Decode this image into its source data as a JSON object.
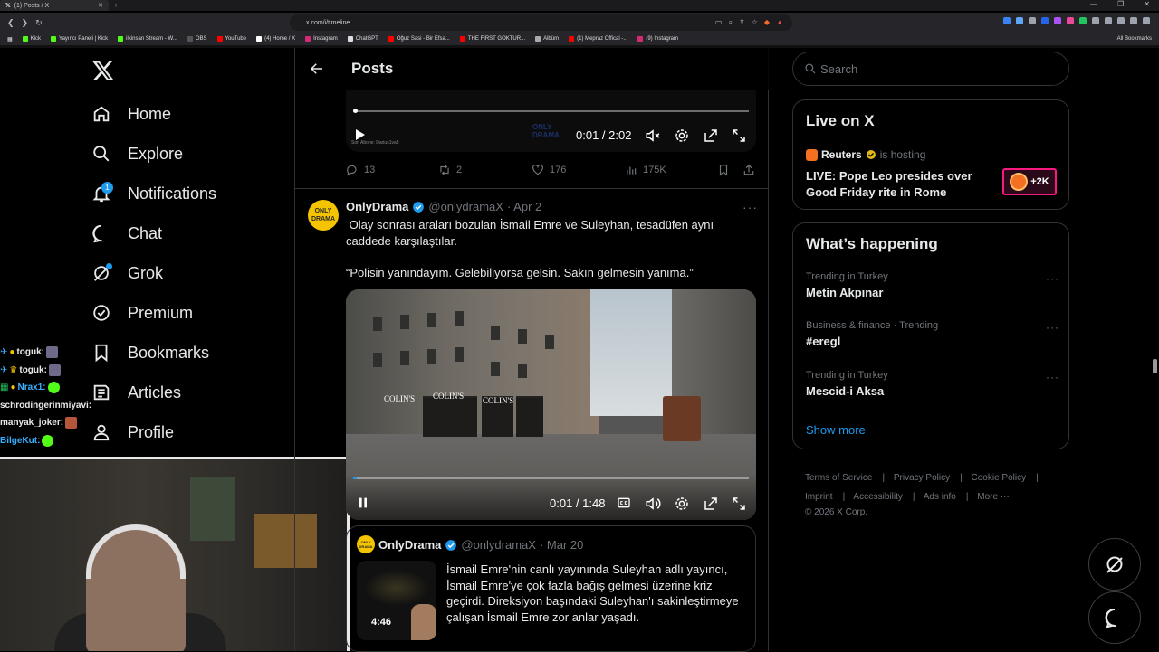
{
  "browser": {
    "tab_title": "(1) Posts / X",
    "url": "x.com/i/timeline",
    "bookmarks": [
      "Kick",
      "Yayıncı Paneli | Kick",
      "ilkinsan Stream - W...",
      "OBS",
      "YouTube",
      "(4) Home / X",
      "Instagram",
      "ChatGPT",
      "Oğuz Sasi - Bir Efsa...",
      "THE FIRST GOKTUR...",
      "Albüm",
      "(1) Mepraz Offical -...",
      "(9) Instagram"
    ],
    "all_bookmarks": "All Bookmarks"
  },
  "nav": {
    "items": [
      {
        "label": "Home",
        "icon": "home-icon"
      },
      {
        "label": "Explore",
        "icon": "search-icon"
      },
      {
        "label": "Notifications",
        "icon": "bell-icon"
      },
      {
        "label": "Chat",
        "icon": "chat-icon"
      },
      {
        "label": "Grok",
        "icon": "grok-icon"
      },
      {
        "label": "Premium",
        "icon": "premium-icon"
      },
      {
        "label": "Bookmarks",
        "icon": "bookmark-icon"
      },
      {
        "label": "Articles",
        "icon": "article-icon"
      },
      {
        "label": "Profile",
        "icon": "profile-icon"
      }
    ],
    "notification_count": "1"
  },
  "stream_chat": [
    {
      "user": "toguk:",
      "color": "#e9e9e9"
    },
    {
      "user": "toguk:",
      "color": "#e9e9e9"
    },
    {
      "user": "Nrax1:",
      "color": "#3bb0ff"
    },
    {
      "user": "schrodingerinmiyavi:",
      "color": "#e9e9e9"
    },
    {
      "user": "manyak_joker:",
      "color": "#e9e9e9"
    },
    {
      "user": "BilgeKut:",
      "color": "#3bb0ff"
    }
  ],
  "header": {
    "title": "Posts"
  },
  "video1": {
    "time": "0:01 / 2:02",
    "watermark": "Son Abone: Darius1va5"
  },
  "actions1": {
    "replies": "13",
    "reposts": "2",
    "likes": "176",
    "views": "175K"
  },
  "post": {
    "name": "OnlyDrama",
    "handle": "@onlydramaX",
    "date": "· Apr 2",
    "avatar_text": "ONLY DRAMA",
    "text": " Olay sonrası araları bozulan İsmail Emre ve Suleyhan, tesadüfen aynı caddede karşılaştılar.\n\n“Polisin yanındayım. Gelebiliyorsa gelsin. Sakın gelmesin yanıma.”",
    "video_time": "0:01 / 1:48",
    "shop_signs": [
      "COLIN'S",
      "COLIN'S",
      "COLIN'S"
    ]
  },
  "quote": {
    "name": "OnlyDrama",
    "handle": "@onlydramaX",
    "date": "· Mar 20",
    "duration": "4:46",
    "text": "İsmail Emre'nin canlı yayınında Suleyhan adlı yayıncı, İsmail Emre'ye çok fazla bağış gelmesi üzerine kriz geçirdi. Direksiyon başındaki Suleyhan'ı sakinleştirmeye çalışan İsmail Emre zor anlar yaşadı."
  },
  "sidebar": {
    "search_placeholder": "Search",
    "live": {
      "title": "Live on X",
      "host": "Reuters",
      "hosting_text": "is hosting",
      "stream_title": "LIVE: Pope Leo presides over Good Friday rite in Rome",
      "listeners": "+2K"
    },
    "happening": {
      "title": "What’s happening",
      "trends": [
        {
          "context": "Trending in Turkey",
          "name": "Metin Akpınar"
        },
        {
          "context": "Business & finance · Trending",
          "name": "#eregl"
        },
        {
          "context": "Trending in Turkey",
          "name": "Mescid-i Aksa"
        }
      ],
      "show_more": "Show more"
    },
    "footer": {
      "links": [
        "Terms of Service",
        "Privacy Policy",
        "Cookie Policy",
        "Imprint",
        "Accessibility",
        "Ads info",
        "More ···"
      ],
      "copyright": "© 2026 X Corp."
    }
  },
  "colors": {
    "accent": "#1d9bf0",
    "live_border": "#f91880",
    "divider": "#2f3336"
  }
}
